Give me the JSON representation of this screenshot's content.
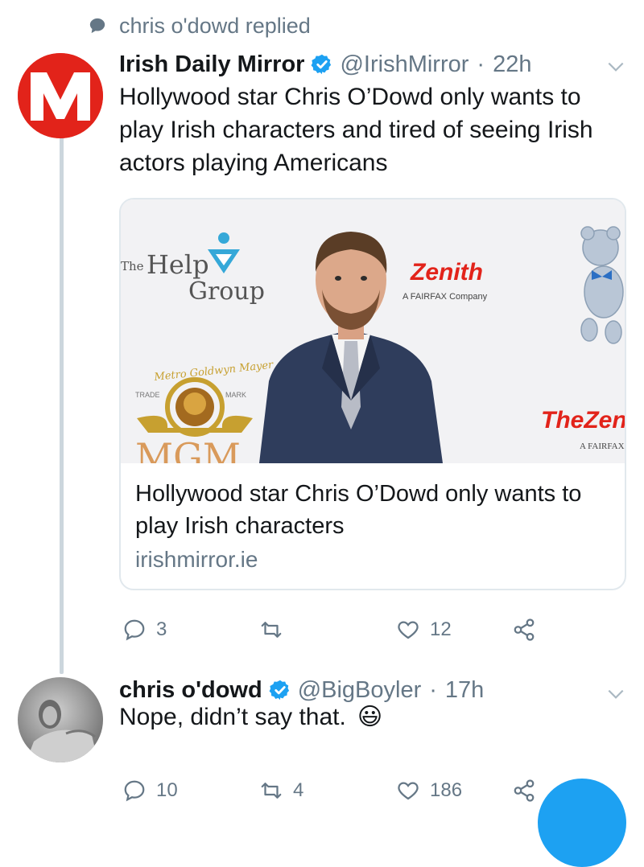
{
  "reply_context": {
    "text": "chris o'dowd replied",
    "icon": "speech-bubble-icon"
  },
  "tweet1": {
    "display_name": "Irish Daily Mirror",
    "handle": "@IrishMirror",
    "separator": "·",
    "time": "22h",
    "text": "Hollywood star Chris O’Dowd only wants to play Irish characters and tired of seeing Irish actors playing Americans",
    "avatar_letter": "M",
    "card": {
      "title": "Hollywood star Chris O’Dowd only wants to play Irish characters",
      "domain": "irishmirror.ie",
      "image_text": {
        "help_the": "The",
        "help_help": "Help",
        "help_group": "Group",
        "zenith": "Zenith",
        "fairfax1": "A FAIRFAX Company",
        "mgm_ring": "Metro Goldwyn Mayer",
        "trade": "TRADE",
        "mark": "MARK",
        "mgm": "MGM",
        "thezen": "TheZen",
        "fairfax2": "A FAIRFAX"
      }
    },
    "actions": {
      "replies": "3",
      "retweets": "",
      "likes": "12"
    }
  },
  "tweet2": {
    "display_name": "chris o'dowd",
    "handle": "@BigBoyler",
    "separator": "·",
    "time": "17h",
    "text": "Nope, didn’t say that.",
    "emoji": "😃",
    "actions": {
      "replies": "10",
      "retweets": "4",
      "likes": "186"
    }
  },
  "colors": {
    "mirror_red": "#e2231a",
    "verified": "#1da1f2",
    "muted": "#657786",
    "like": "#657786"
  }
}
